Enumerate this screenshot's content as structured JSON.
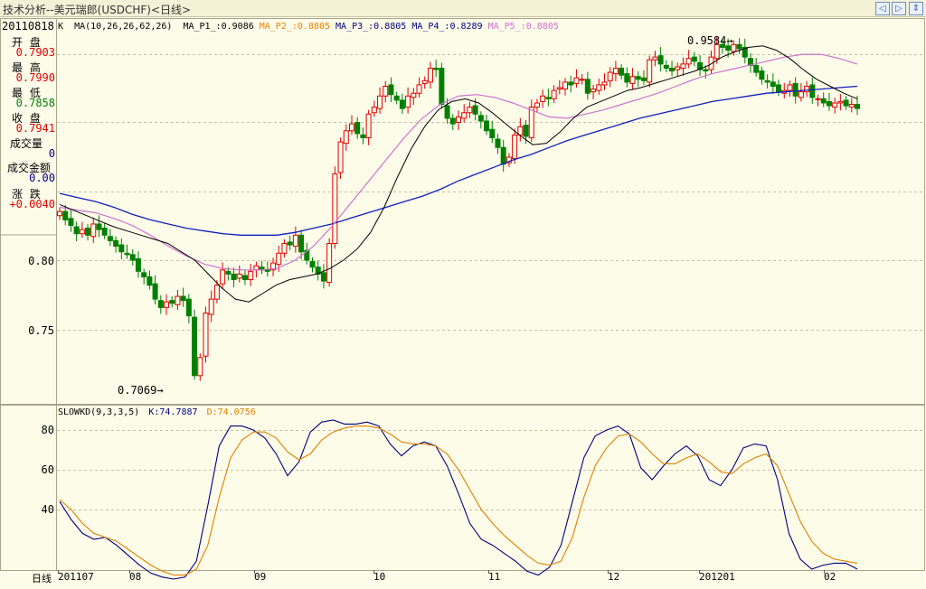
{
  "window": {
    "title": "技术分析--美元瑞郎(USDCHF)<日线>",
    "buttons": [
      "prev-icon",
      "next-icon",
      "expand-icon"
    ]
  },
  "info_panel": {
    "date": "20110818",
    "fields": [
      {
        "label": "开 盘",
        "value": "0.7903",
        "color": "#E00000"
      },
      {
        "label": "最 高",
        "value": "0.7990",
        "color": "#E00000"
      },
      {
        "label": "最 低",
        "value": "0.7858",
        "color": "#008000"
      },
      {
        "label": "收 盘",
        "value": "0.7941",
        "color": "#E00000"
      },
      {
        "label": "成交量",
        "value": "0",
        "color": "#000080"
      },
      {
        "label": "成交金额",
        "value": "0.00",
        "color": "#000080"
      },
      {
        "label": "涨 跌",
        "value": "+0.0040",
        "color": "#E00000"
      }
    ]
  },
  "price_legend": {
    "period_tag": "K",
    "ma_def": "MA(10,26,26,62,26)",
    "items": [
      {
        "label": "MA_P1_:0.9086",
        "color": "#000000"
      },
      {
        "label": "MA_P2_:0.8805",
        "color": "#F08000"
      },
      {
        "label": "MA_P3_:0.8805",
        "color": "#000080"
      },
      {
        "label": "MA_P4_:0.8289",
        "color": "#000080"
      },
      {
        "label": "MA_P5_:0.8805",
        "color": "#D070D0"
      }
    ]
  },
  "indicator_legend": {
    "name": "SLOWKD(9,3,3,5)",
    "k": "K:74.7887",
    "d": "D:74.0756",
    "k_color": "#000080",
    "d_color": "#E08000"
  },
  "annotations": {
    "high": "0.9584",
    "low": "0.7069"
  },
  "price_axis": {
    "ticks": [
      "0.80",
      "0.75"
    ]
  },
  "kd_axis": {
    "ticks": [
      "80",
      "60",
      "40"
    ]
  },
  "x_axis": {
    "label": "日线",
    "ticks": [
      "201107",
      "08",
      "09",
      "10",
      "11",
      "12",
      "201201",
      "02"
    ]
  },
  "chart_data": [
    {
      "type": "candlestick",
      "title": "美元瑞郎(USDCHF) 日线",
      "y_ticks": [
        0.8,
        0.75
      ],
      "candle_up_color": "#E00000",
      "candle_down_color": "#008000",
      "closes": [
        0.835,
        0.829,
        0.825,
        0.819,
        0.822,
        0.818,
        0.826,
        0.822,
        0.818,
        0.814,
        0.81,
        0.806,
        0.804,
        0.8,
        0.792,
        0.788,
        0.782,
        0.772,
        0.766,
        0.77,
        0.769,
        0.774,
        0.771,
        0.76,
        0.717,
        0.73,
        0.762,
        0.772,
        0.782,
        0.793,
        0.79,
        0.786,
        0.79,
        0.786,
        0.792,
        0.796,
        0.793,
        0.792,
        0.798,
        0.805,
        0.812,
        0.811,
        0.818,
        0.806,
        0.8,
        0.795,
        0.79,
        0.785,
        0.812,
        0.862,
        0.885,
        0.893,
        0.898,
        0.891,
        0.888,
        0.905,
        0.91,
        0.918,
        0.925,
        0.919,
        0.915,
        0.909,
        0.918,
        0.92,
        0.926,
        0.929,
        0.938,
        0.937,
        0.912,
        0.902,
        0.898,
        0.903,
        0.906,
        0.91,
        0.905,
        0.9,
        0.893,
        0.888,
        0.881,
        0.869,
        0.874,
        0.89,
        0.896,
        0.889,
        0.91,
        0.913,
        0.918,
        0.916,
        0.922,
        0.924,
        0.928,
        0.926,
        0.931,
        0.93,
        0.92,
        0.923,
        0.926,
        0.928,
        0.935,
        0.938,
        0.933,
        0.928,
        0.932,
        0.93,
        0.929,
        0.944,
        0.946,
        0.941,
        0.938,
        0.936,
        0.939,
        0.941,
        0.945,
        0.943,
        0.937,
        0.936,
        0.946,
        0.955,
        0.953,
        0.951,
        0.955,
        0.952,
        0.946,
        0.94,
        0.935,
        0.93,
        0.928,
        0.925,
        0.921,
        0.922,
        0.926,
        0.918,
        0.921,
        0.925,
        0.917,
        0.916,
        0.913,
        0.911,
        0.913,
        0.914,
        0.911,
        0.912,
        0.909
      ],
      "ma_p1_closes_avg": [
        0.84,
        0.836,
        0.832,
        0.828,
        0.824,
        0.821,
        0.818,
        0.815,
        0.812,
        0.806,
        0.8,
        0.79,
        0.78,
        0.772,
        0.77,
        0.776,
        0.782,
        0.786,
        0.788,
        0.79,
        0.794,
        0.8,
        0.808,
        0.82,
        0.838,
        0.86,
        0.88,
        0.896,
        0.908,
        0.914,
        0.916,
        0.913,
        0.906,
        0.898,
        0.89,
        0.883,
        0.884,
        0.892,
        0.902,
        0.91,
        0.914,
        0.918,
        0.922,
        0.924,
        0.927,
        0.93,
        0.933,
        0.936,
        0.94,
        0.946,
        0.95,
        0.953,
        0.954,
        0.951,
        0.945,
        0.937,
        0.93,
        0.925,
        0.92,
        0.916
      ],
      "ma_p4": [
        0.848,
        0.845,
        0.842,
        0.838,
        0.833,
        0.829,
        0.826,
        0.823,
        0.821,
        0.819,
        0.818,
        0.818,
        0.818,
        0.82,
        0.823,
        0.826,
        0.83,
        0.834,
        0.838,
        0.842,
        0.846,
        0.851,
        0.857,
        0.862,
        0.867,
        0.872,
        0.876,
        0.881,
        0.886,
        0.89,
        0.894,
        0.898,
        0.902,
        0.905,
        0.908,
        0.911,
        0.914,
        0.916,
        0.918,
        0.92,
        0.921,
        0.922,
        0.923,
        0.924,
        0.925
      ],
      "ma_p5": [
        0.838,
        0.836,
        0.834,
        0.83,
        0.825,
        0.818,
        0.81,
        0.803,
        0.797,
        0.794,
        0.793,
        0.793,
        0.794,
        0.8,
        0.81,
        0.824,
        0.84,
        0.856,
        0.872,
        0.888,
        0.902,
        0.912,
        0.918,
        0.919,
        0.917,
        0.913,
        0.908,
        0.903,
        0.902,
        0.905,
        0.908,
        0.912,
        0.916,
        0.92,
        0.925,
        0.93,
        0.934,
        0.937,
        0.94,
        0.943,
        0.946,
        0.948,
        0.948,
        0.945,
        0.941
      ],
      "annotated_high": 0.9584,
      "annotated_low": 0.7069
    },
    {
      "type": "line",
      "title": "SLOWKD(9,3,3,5)",
      "y_ticks": [
        80,
        60,
        40
      ],
      "series": [
        {
          "name": "K",
          "color": "#000080",
          "values": [
            44,
            35,
            28,
            25,
            26,
            22,
            17,
            12,
            8,
            6,
            5,
            6,
            14,
            42,
            72,
            82,
            82,
            80,
            76,
            68,
            57,
            64,
            79,
            84,
            85,
            83,
            83,
            84,
            82,
            73,
            67,
            72,
            74,
            72,
            62,
            48,
            33,
            25,
            22,
            18,
            14,
            9,
            7,
            11,
            22,
            44,
            66,
            77,
            80,
            82,
            78,
            61,
            55,
            62,
            68,
            72,
            67,
            55,
            52,
            60,
            71,
            73,
            72,
            55,
            28,
            15,
            10,
            12,
            13,
            13,
            10
          ]
        },
        {
          "name": "D",
          "color": "#E08000",
          "values": [
            45,
            40,
            33,
            28,
            26,
            24,
            20,
            16,
            12,
            9,
            7,
            7,
            10,
            22,
            46,
            66,
            75,
            79,
            79,
            76,
            69,
            65,
            68,
            75,
            79,
            81,
            82,
            82,
            81,
            78,
            74,
            73,
            73,
            72,
            68,
            60,
            50,
            40,
            33,
            27,
            22,
            17,
            13,
            12,
            14,
            26,
            46,
            62,
            71,
            77,
            78,
            74,
            68,
            63,
            63,
            66,
            68,
            64,
            59,
            58,
            63,
            66,
            68,
            62,
            48,
            34,
            24,
            18,
            15,
            14,
            13
          ]
        }
      ]
    }
  ]
}
